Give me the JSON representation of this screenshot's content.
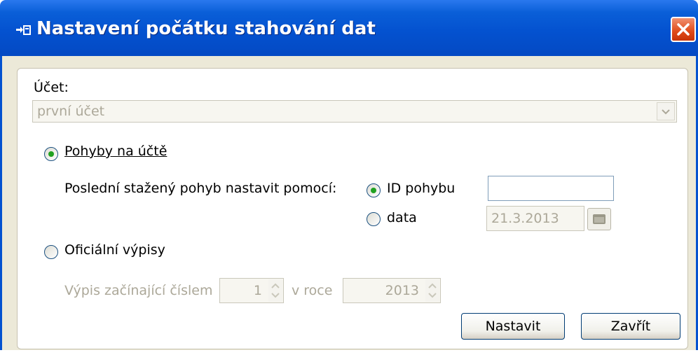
{
  "window": {
    "title": "Nastavení počátku stahování dat",
    "close_icon": "close-icon"
  },
  "colors": {
    "titlebar": "#0452d0",
    "client_bg": "#ece9d8",
    "close_button": "#e04a18",
    "radio_dot": "#21a121",
    "disabled_text": "#aca899"
  },
  "account": {
    "label": "Účet:",
    "value": "první účet"
  },
  "movements": {
    "label": "Pohyby na účtě",
    "selected": true,
    "set_by_label": "Poslední stažený pohyb nastavit pomocí:",
    "id_option": {
      "label": "ID pohybu",
      "selected": true,
      "value": ""
    },
    "date_option": {
      "label": "data",
      "selected": false,
      "value": "21.3.2013"
    }
  },
  "statements": {
    "label": "Oficiální výpisy",
    "selected": false,
    "start_number_label": "Výpis začínající číslem",
    "start_number_value": "1",
    "year_label": "v roce",
    "year_value": "2013"
  },
  "buttons": {
    "set": "Nastavit",
    "close": "Zavřít"
  }
}
